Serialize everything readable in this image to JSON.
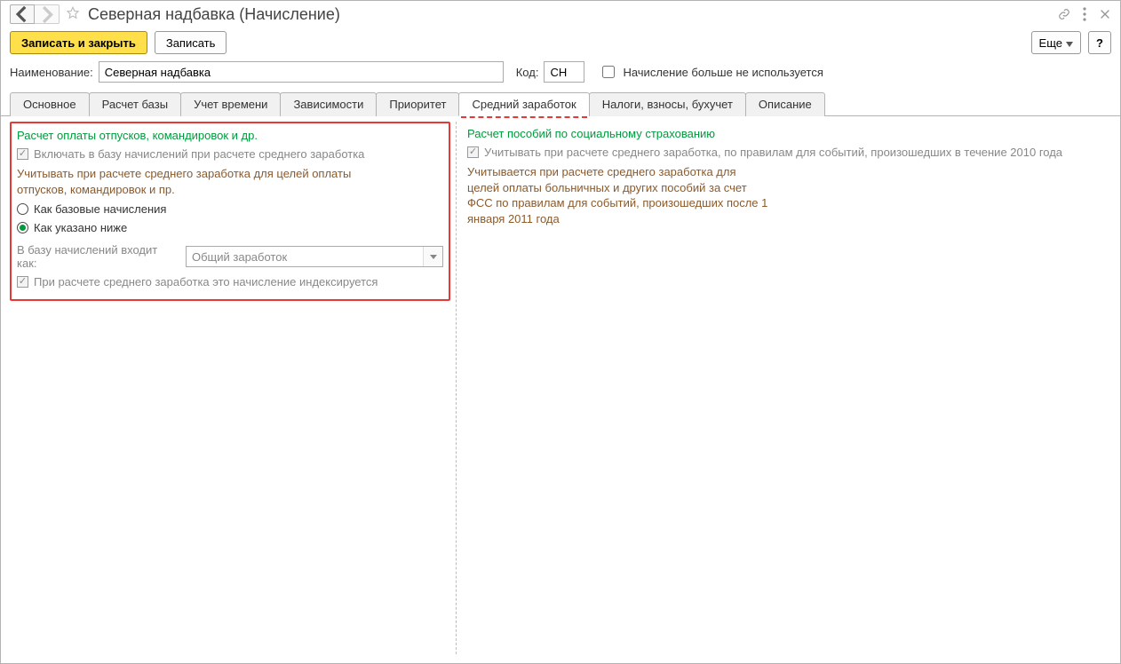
{
  "title": "Северная надбавка (Начисление)",
  "toolbar": {
    "save_close": "Записать и закрыть",
    "save": "Записать",
    "more": "Еще",
    "help": "?"
  },
  "fields": {
    "name_label": "Наименование:",
    "name_value": "Северная надбавка",
    "code_label": "Код:",
    "code_value": "СН",
    "not_used_label": "Начисление больше не используется"
  },
  "tabs": [
    "Основное",
    "Расчет базы",
    "Учет времени",
    "Зависимости",
    "Приоритет",
    "Средний заработок",
    "Налоги, взносы, бухучет",
    "Описание"
  ],
  "active_tab_index": 5,
  "left": {
    "title": "Расчет оплаты отпусков, командировок и др.",
    "include_base": "Включать в базу начислений при расчете среднего заработка",
    "consider": "Учитывать при расчете среднего заработка для целей оплаты отпусков, командировок и пр.",
    "radio_base": "Как базовые начисления",
    "radio_below": "Как указано ниже",
    "in_base_label": "В базу начислений входит как:",
    "in_base_value": "Общий заработок",
    "indexed": "При расчете среднего заработка это начисление индексируется"
  },
  "right": {
    "title": "Расчет пособий по социальному страхованию",
    "consider_2010": "Учитывать при расчете среднего заработка, по правилам для событий, произошедших в течение 2010 года",
    "desc": "Учитывается при расчете среднего заработка для целей оплаты больничных и других пособий за счет ФСС по правилам для событий, произошедших после 1 января 2011 года"
  }
}
